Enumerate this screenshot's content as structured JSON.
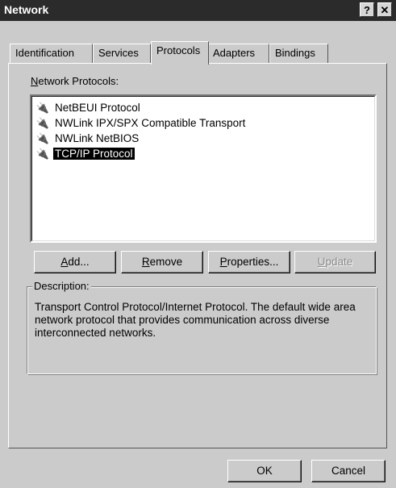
{
  "window": {
    "title": "Network",
    "help_label": "?",
    "close_label": "✕"
  },
  "tabs": [
    {
      "label": "Identification"
    },
    {
      "label": "Services"
    },
    {
      "label": "Protocols",
      "active": true
    },
    {
      "label": "Adapters"
    },
    {
      "label": "Bindings"
    }
  ],
  "protocols": {
    "label_prefix": "N",
    "label_rest": "etwork Protocols:",
    "items": [
      {
        "label": "NetBEUI Protocol",
        "icon": "network-protocol-icon"
      },
      {
        "label": "NWLink IPX/SPX Compatible Transport",
        "icon": "network-protocol-icon"
      },
      {
        "label": "NWLink NetBIOS",
        "icon": "network-protocol-icon"
      },
      {
        "label": "TCP/IP Protocol",
        "icon": "network-protocol-icon",
        "selected": true
      }
    ]
  },
  "buttons": {
    "add": {
      "u": "A",
      "rest": "dd..."
    },
    "remove": {
      "u": "R",
      "rest": "emove"
    },
    "properties": {
      "u": "P",
      "rest": "roperties..."
    },
    "update": {
      "u": "U",
      "rest": "pdate"
    }
  },
  "description": {
    "label": "Description:",
    "text": "Transport Control Protocol/Internet Protocol. The default wide area network protocol that provides communication across diverse interconnected networks."
  },
  "footer": {
    "ok_label": "OK",
    "cancel_label": "Cancel"
  }
}
